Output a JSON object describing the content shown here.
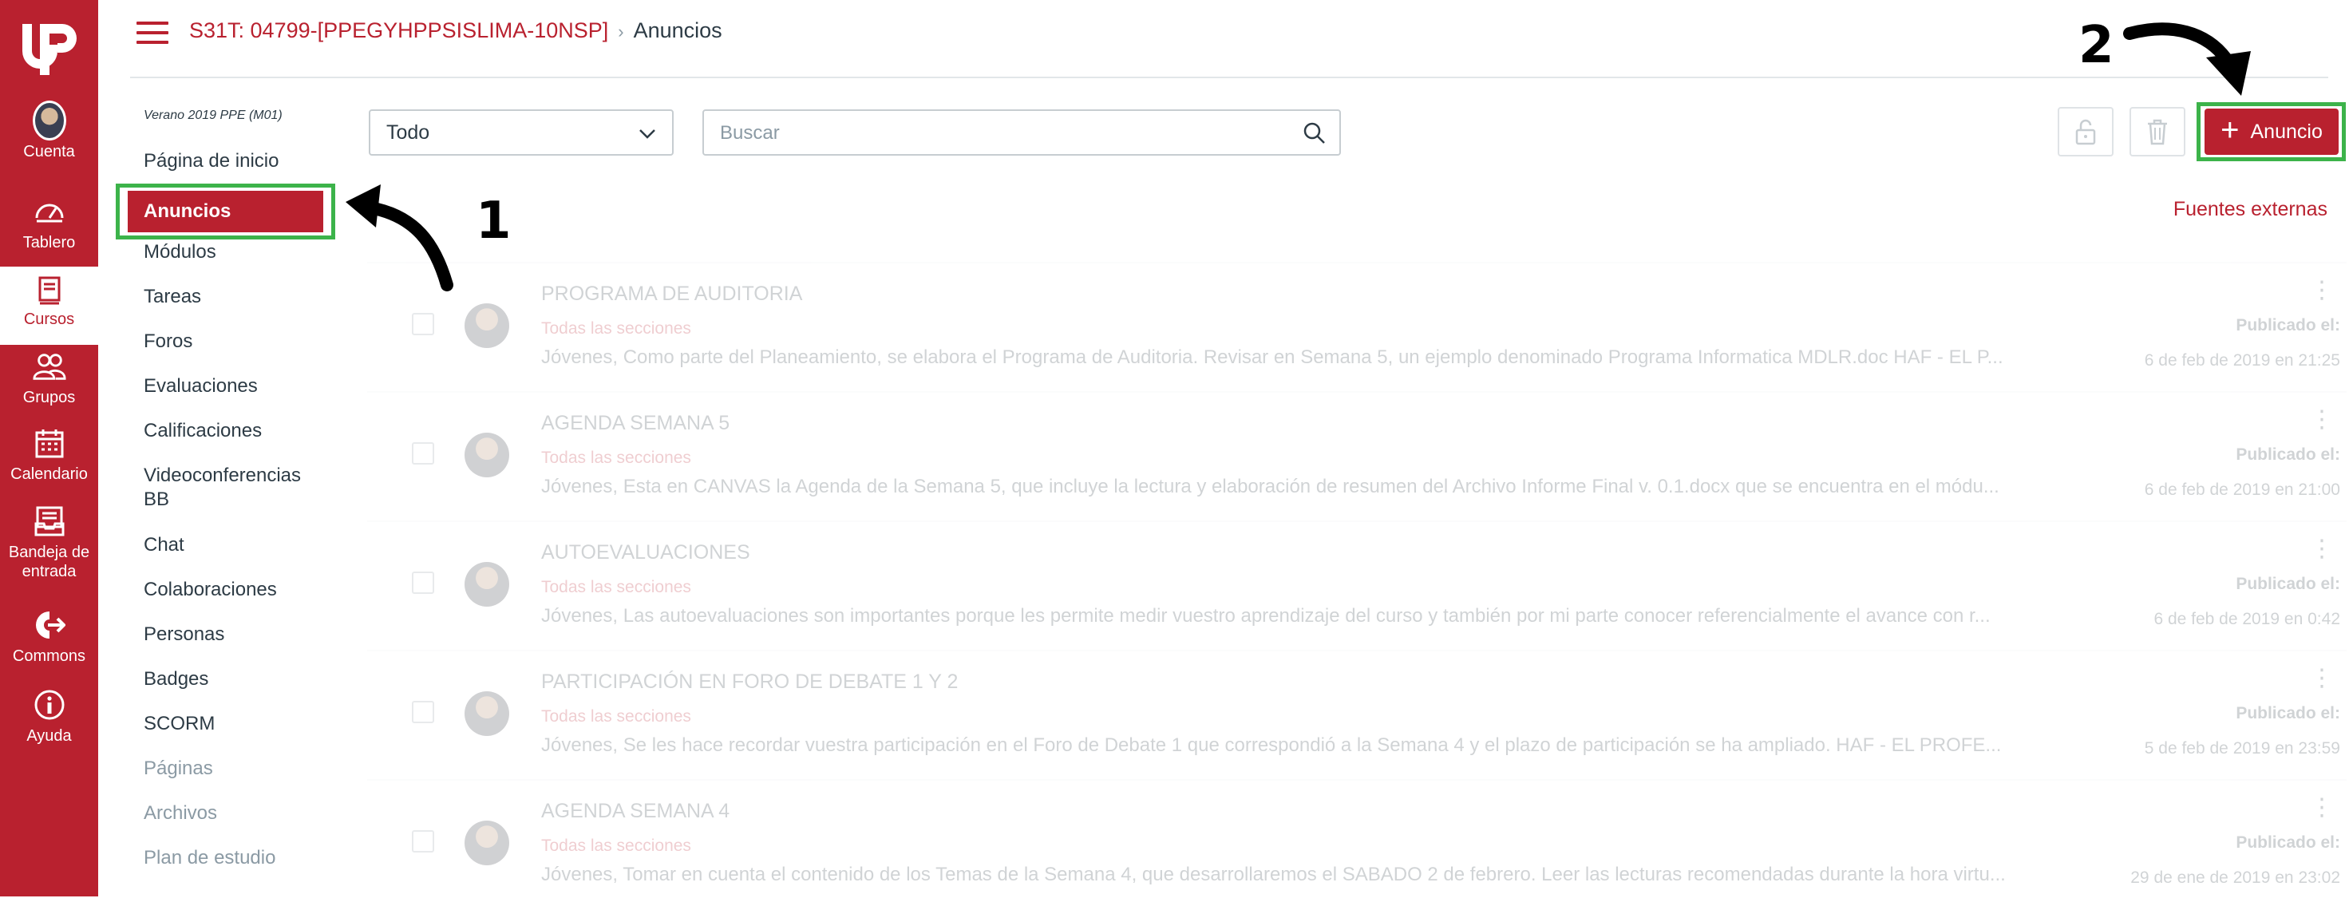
{
  "global_nav": {
    "items": [
      {
        "label": "Cuenta",
        "icon": "avatar"
      },
      {
        "label": "Tablero",
        "icon": "dashboard-icon"
      },
      {
        "label": "Cursos",
        "icon": "book-icon"
      },
      {
        "label": "Grupos",
        "icon": "users-icon"
      },
      {
        "label": "Calendario",
        "icon": "calendar-icon"
      },
      {
        "label": "Bandeja de entrada",
        "icon": "inbox-icon"
      },
      {
        "label": "Commons",
        "icon": "commons-icon"
      },
      {
        "label": "Ayuda",
        "icon": "help-icon"
      }
    ]
  },
  "header": {
    "course": "S31T: 04799-[PPEGYHPPSISLIMA-10NSP]",
    "current": "Anuncios"
  },
  "course_nav": {
    "term": "Verano 2019 PPE (M01)",
    "items": [
      "Página de inicio",
      "Anuncios",
      "Módulos",
      "Tareas",
      "Foros",
      "Evaluaciones",
      "Calificaciones",
      "Videoconferencias",
      "BB",
      "Chat",
      "Colaboraciones",
      "Personas",
      "Badges",
      "SCORM",
      "Páginas",
      "Archivos",
      "Plan de estudio"
    ]
  },
  "toolbar": {
    "filter_value": "Todo",
    "search_placeholder": "Buscar",
    "add_label": "Anuncio",
    "external_feeds": "Fuentes externas"
  },
  "annotations": {
    "step1": "1",
    "step2": "2"
  },
  "announcements": [
    {
      "title": "PROGRAMA DE AUDITORIA",
      "sections": "Todas las secciones",
      "excerpt": "Jóvenes, Como parte del Planeamiento, se elabora el Programa de Auditoria. Revisar en Semana 5, un ejemplo denominado Programa Informatica MDLR.doc HAF - EL P...",
      "published_label": "Publicado el:",
      "date": "6 de feb de 2019 en 21:25"
    },
    {
      "title": "AGENDA SEMANA 5",
      "sections": "Todas las secciones",
      "excerpt": "Jóvenes, Esta en CANVAS la Agenda de la Semana 5, que incluye la lectura y elaboración de resumen del Archivo Informe Final v. 0.1.docx que se encuentra en el módu...",
      "published_label": "Publicado el:",
      "date": "6 de feb de 2019 en 21:00"
    },
    {
      "title": "AUTOEVALUACIONES",
      "sections": "Todas las secciones",
      "excerpt": "Jóvenes, Las autoevaluaciones son importantes porque les permite medir vuestro aprendizaje del curso y también por mi parte conocer referencialmente el avance con r...",
      "published_label": "Publicado el:",
      "date": "6 de feb de 2019 en 0:42"
    },
    {
      "title": "PARTICIPACIÓN EN FORO DE DEBATE 1 Y 2",
      "sections": "Todas las secciones",
      "excerpt": "Jóvenes, Se les hace recordar vuestra participación en el Foro de Debate 1 que correspondió a la Semana 4 y el plazo de participación se ha ampliado. HAF - EL PROFE...",
      "published_label": "Publicado el:",
      "date": "5 de feb de 2019 en 23:59"
    },
    {
      "title": "AGENDA SEMANA 4",
      "sections": "Todas las secciones",
      "excerpt": "Jóvenes, Tomar en cuenta el contenido de los Temas de la Semana 4, que desarrollaremos el SABADO 2 de febrero. Leer las lecturas recomendadas durante la hora virtu...",
      "published_label": "Publicado el:",
      "date": "29 de ene de 2019 en 23:02"
    }
  ]
}
